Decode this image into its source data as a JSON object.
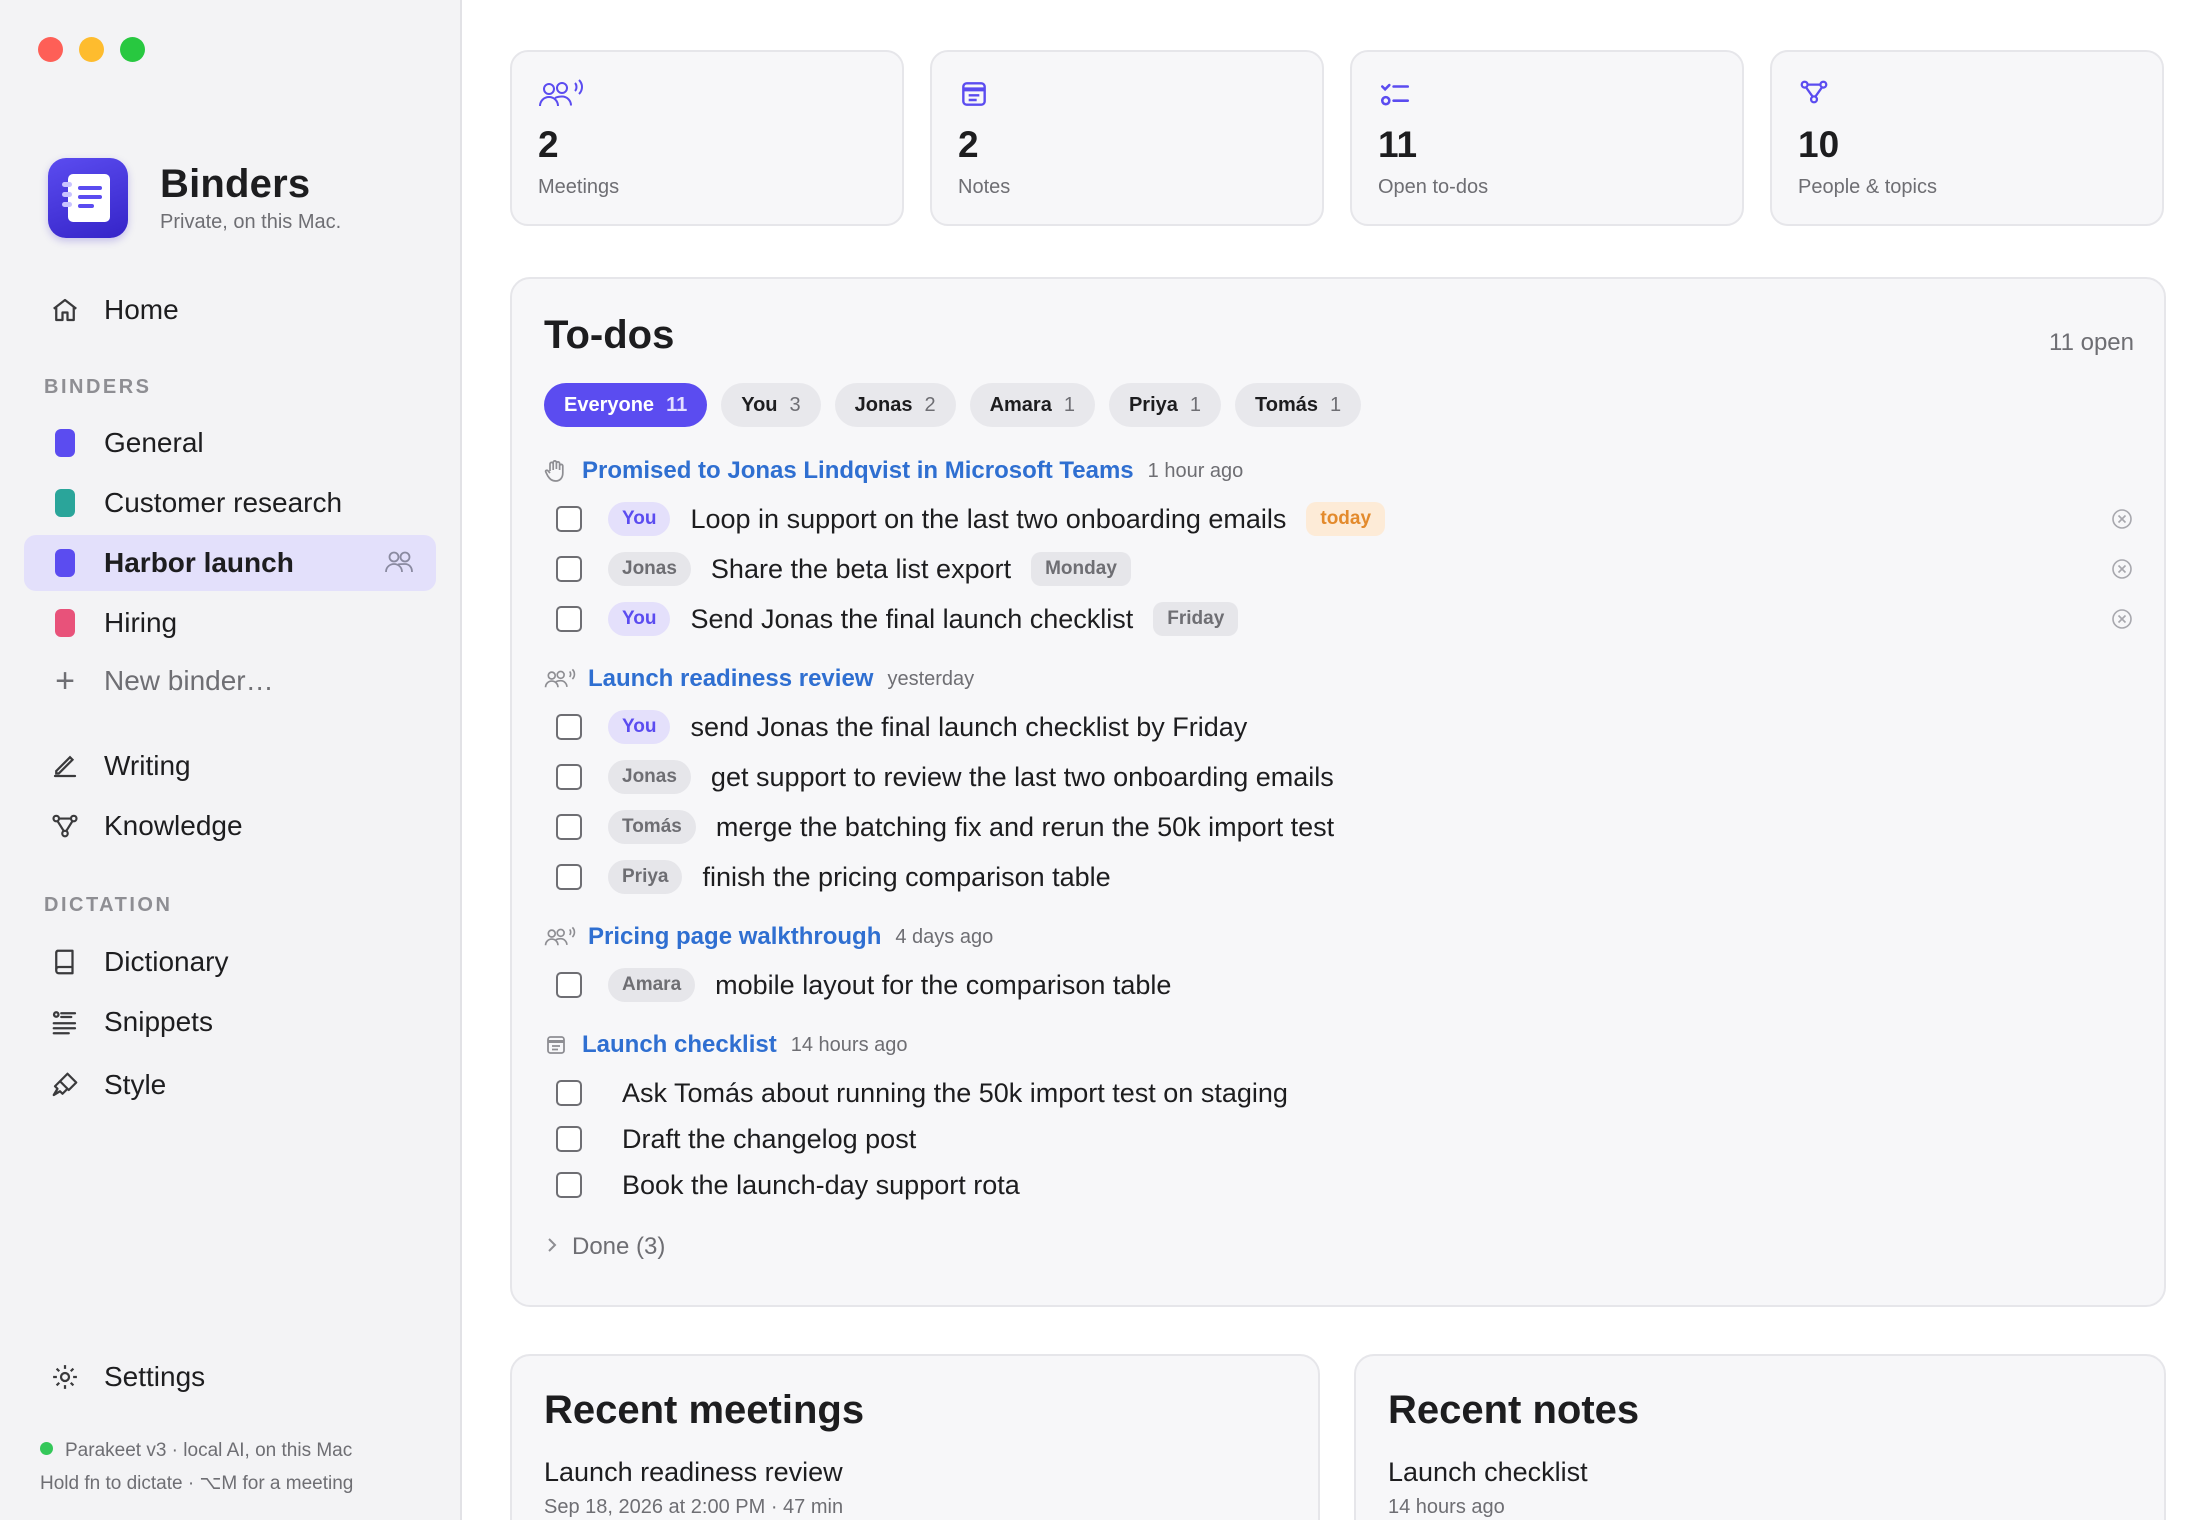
{
  "sidebar": {
    "brand": {
      "title": "Binders",
      "subtitle": "Private, on this Mac."
    },
    "home_label": "Home",
    "binders_header": "BINDERS",
    "binders": [
      {
        "label": "General",
        "color": "#5b4cf0"
      },
      {
        "label": "Customer research",
        "color": "#2aa59a"
      },
      {
        "label": "Harbor launch",
        "color": "#5b4cf0",
        "active": true,
        "shared": true
      },
      {
        "label": "Hiring",
        "color": "#e8527a"
      }
    ],
    "new_binder_label": "New binder…",
    "writing_label": "Writing",
    "knowledge_label": "Knowledge",
    "dictation_header": "DICTATION",
    "dictation_items": [
      "Dictionary",
      "Snippets",
      "Style"
    ],
    "settings_label": "Settings",
    "status_line1": "Parakeet v3 · local AI, on this Mac",
    "status_line2": "Hold fn to dictate · ⌥M for a meeting"
  },
  "stats": [
    {
      "value": "2",
      "label": "Meetings",
      "icon": "people-icon"
    },
    {
      "value": "2",
      "label": "Notes",
      "icon": "note-icon"
    },
    {
      "value": "11",
      "label": "Open to-dos",
      "icon": "checklist-icon"
    },
    {
      "value": "10",
      "label": "People & topics",
      "icon": "graph-icon"
    }
  ],
  "todos": {
    "title": "To-dos",
    "open_count": "11 open",
    "filters": [
      {
        "label": "Everyone",
        "count": "11",
        "selected": true
      },
      {
        "label": "You",
        "count": "3"
      },
      {
        "label": "Jonas",
        "count": "2"
      },
      {
        "label": "Amara",
        "count": "1"
      },
      {
        "label": "Priya",
        "count": "1"
      },
      {
        "label": "Tomás",
        "count": "1"
      }
    ],
    "groups": [
      {
        "title": "Promised to Jonas Lindqvist in Microsoft Teams",
        "time": "1 hour ago",
        "icon": "hand-icon",
        "items": [
          {
            "who": "You",
            "text": "Loop in support on the last two onboarding emails",
            "due": "today"
          },
          {
            "who": "Jonas",
            "text": "Share the beta list export",
            "due": "Monday"
          },
          {
            "who": "You",
            "text": "Send Jonas the final launch checklist",
            "due": "Friday"
          }
        ]
      },
      {
        "title": "Launch readiness review",
        "time": "yesterday",
        "icon": "people-icon",
        "items": [
          {
            "who": "You",
            "text": "send Jonas the final launch checklist by Friday"
          },
          {
            "who": "Jonas",
            "text": "get support to review the last two onboarding emails"
          },
          {
            "who": "Tomás",
            "text": "merge the batching fix and rerun the 50k import test"
          },
          {
            "who": "Priya",
            "text": "finish the pricing comparison table"
          }
        ]
      },
      {
        "title": "Pricing page walkthrough",
        "time": "4 days ago",
        "icon": "people-icon",
        "items": [
          {
            "who": "Amara",
            "text": "mobile layout for the comparison table"
          }
        ]
      },
      {
        "title": "Launch checklist",
        "time": "14 hours ago",
        "icon": "note-icon",
        "items": [
          {
            "text": "Ask Tomás about running the 50k import test on staging"
          },
          {
            "text": "Draft the changelog post"
          },
          {
            "text": "Book the launch-day support rota"
          }
        ]
      }
    ],
    "done_label": "Done (3)"
  },
  "recent_meetings": {
    "title": "Recent meetings",
    "item": "Launch readiness review",
    "meta": "Sep 18, 2026 at 2:00 PM · 47 min"
  },
  "recent_notes": {
    "title": "Recent notes",
    "item": "Launch checklist",
    "meta": "14 hours ago"
  }
}
